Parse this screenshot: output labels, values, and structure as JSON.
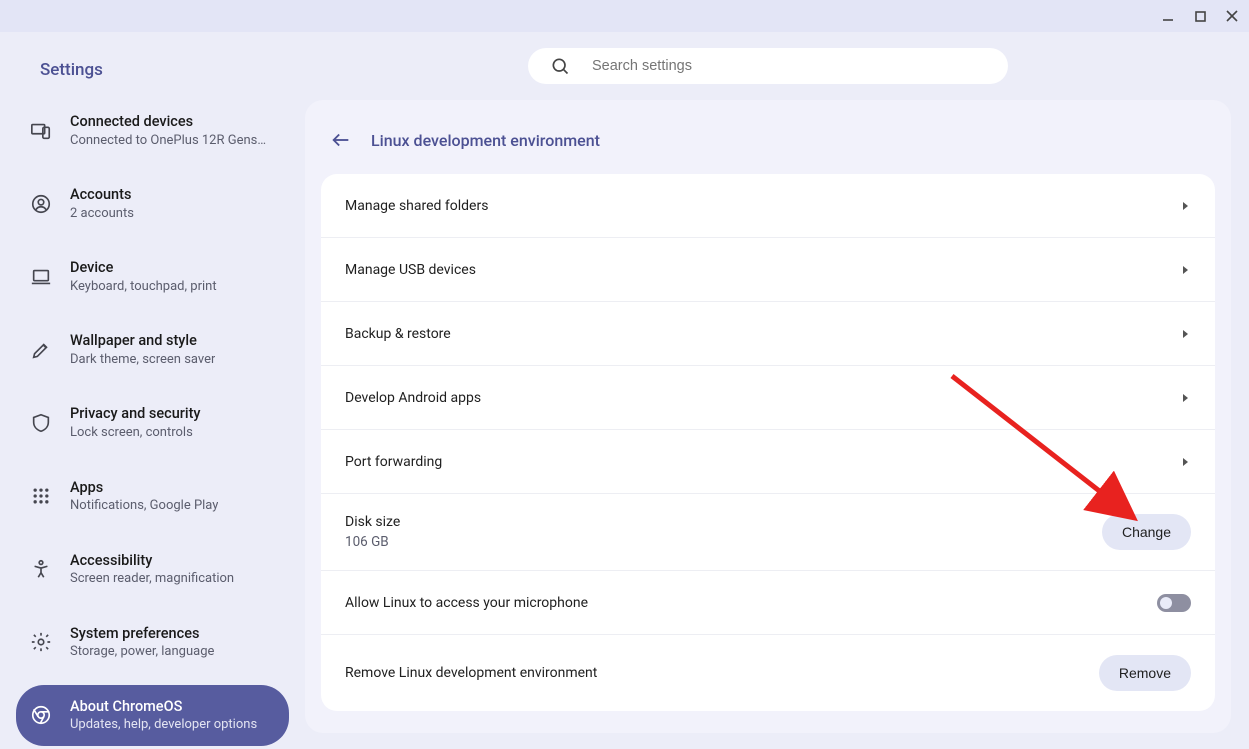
{
  "app_title": "Settings",
  "search": {
    "placeholder": "Search settings"
  },
  "sidebar": {
    "items": [
      {
        "label": "Connected devices",
        "sub": "Connected to OnePlus 12R Gens…"
      },
      {
        "label": "Accounts",
        "sub": "2 accounts"
      },
      {
        "label": "Device",
        "sub": "Keyboard, touchpad, print"
      },
      {
        "label": "Wallpaper and style",
        "sub": "Dark theme, screen saver"
      },
      {
        "label": "Privacy and security",
        "sub": "Lock screen, controls"
      },
      {
        "label": "Apps",
        "sub": "Notifications, Google Play"
      },
      {
        "label": "Accessibility",
        "sub": "Screen reader, magnification"
      },
      {
        "label": "System preferences",
        "sub": "Storage, power, language"
      },
      {
        "label": "About ChromeOS",
        "sub": "Updates, help, developer options"
      }
    ]
  },
  "page": {
    "title": "Linux development environment",
    "rows": {
      "shared_folders": "Manage shared folders",
      "usb": "Manage USB devices",
      "backup": "Backup & restore",
      "android": "Develop Android apps",
      "port": "Port forwarding",
      "disk_label": "Disk size",
      "disk_value": "106 GB",
      "change_btn": "Change",
      "mic": "Allow Linux to access your microphone",
      "remove_label": "Remove Linux development environment",
      "remove_btn": "Remove"
    }
  }
}
